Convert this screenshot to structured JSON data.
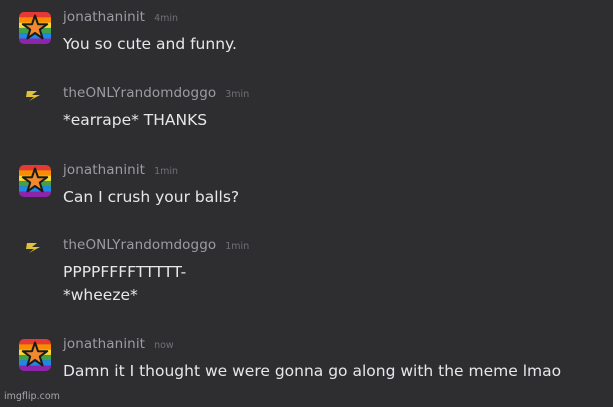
{
  "messages": [
    {
      "author": "jonathaninit",
      "avatar_icon": "rainbow-star-icon",
      "time": "4min",
      "lines": [
        "You so cute and funny."
      ]
    },
    {
      "author": "theONLYrandomdoggo",
      "avatar_icon": "lightning-bolt-icon",
      "time": "3min",
      "lines": [
        "*earrape* THANKS"
      ]
    },
    {
      "author": "jonathaninit",
      "avatar_icon": "rainbow-star-icon",
      "time": "1min",
      "lines": [
        "Can I crush your balls?"
      ]
    },
    {
      "author": "theONLYrandomdoggo",
      "avatar_icon": "lightning-bolt-icon",
      "time": "1min",
      "lines": [
        "PPPPFFFFTTTTT-",
        "*wheeze*"
      ]
    },
    {
      "author": "jonathaninit",
      "avatar_icon": "rainbow-star-icon",
      "time": "now",
      "lines": [
        "Damn it I thought we were gonna go along with the meme lmao"
      ]
    }
  ],
  "watermark": "imgflip.com",
  "colors": {
    "background": "#2e2e31",
    "username": "#9c9ca2",
    "timestamp": "#707075",
    "message_text": "#e7e7ea",
    "bolt": "#e0c23a",
    "star": "#f2892e"
  }
}
